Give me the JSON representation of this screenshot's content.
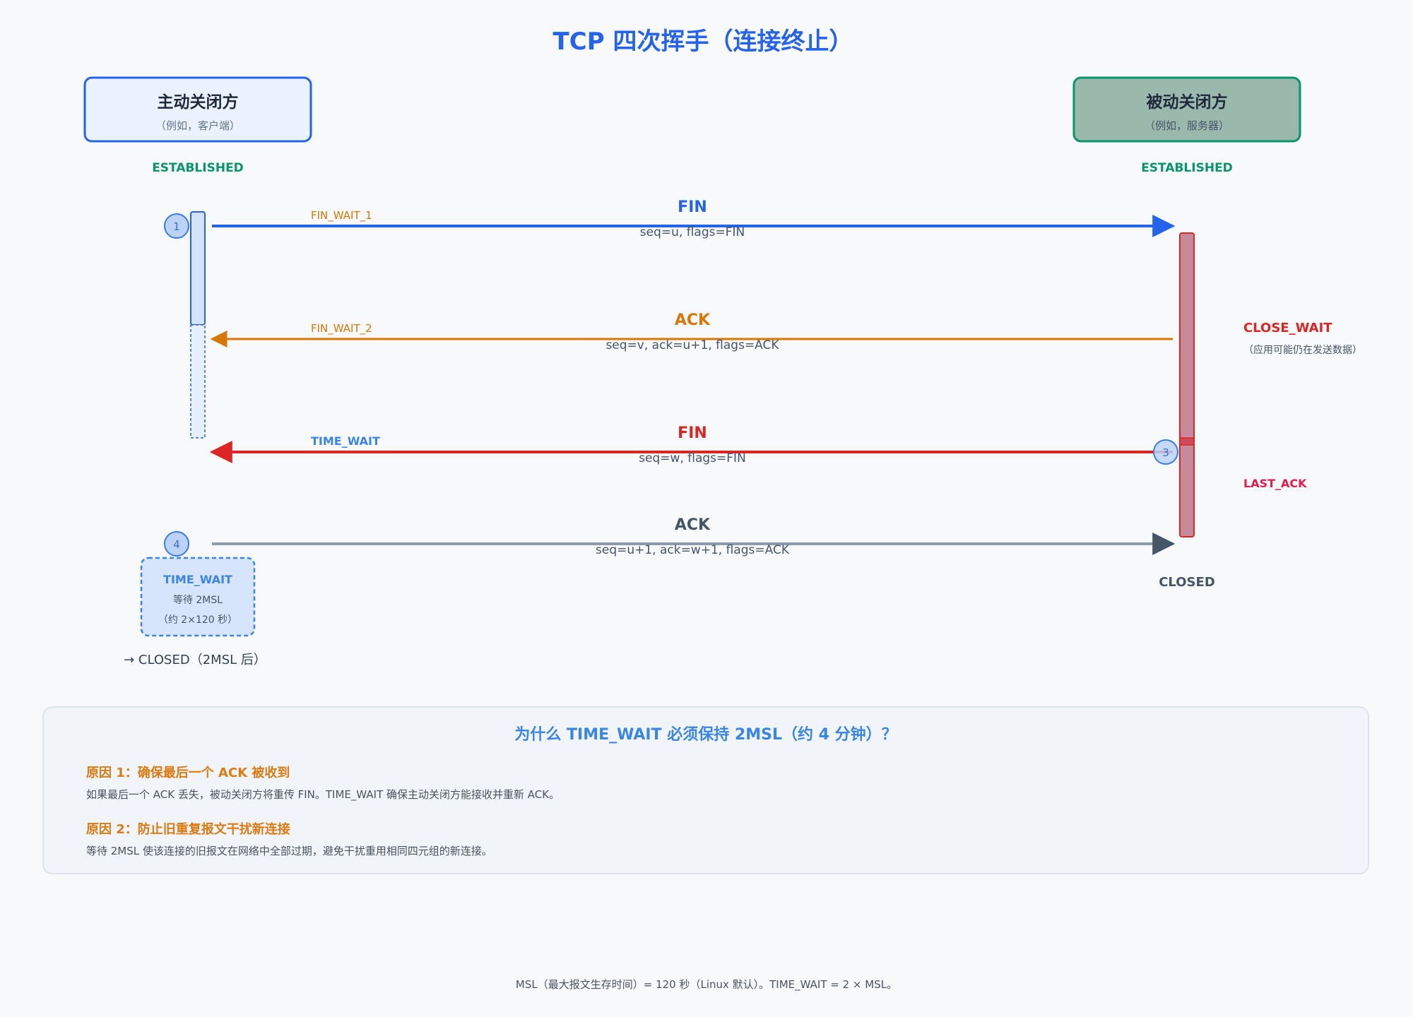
{
  "title": "TCP 四次挥手（连接终止）",
  "active_party": {
    "name": "主动关闭方",
    "sub": "（例如，客户端）",
    "initial_state": "ESTABLISHED",
    "time_wait_box": {
      "title": "TIME_WAIT",
      "line1": "等待 2MSL",
      "line2": "（约 2×120 秒）"
    },
    "final_state": "→ CLOSED（2MSL 后）"
  },
  "passive_party": {
    "name": "被动关闭方",
    "sub": "（例如，服务器）",
    "initial_state": "ESTABLISHED",
    "final_state": "CLOSED"
  },
  "messages": [
    {
      "step": "1",
      "label": "FIN",
      "detail": "seq=u, flags=FIN",
      "sender_state": "FIN_WAIT_1",
      "color": "#2563eb"
    },
    {
      "step": "",
      "label": "ACK",
      "detail": "seq=v, ack=u+1, flags=ACK",
      "sender_state": "FIN_WAIT_2",
      "color": "#d97706"
    },
    {
      "step": "3",
      "label": "FIN",
      "detail": "seq=w, flags=FIN",
      "sender_state": "TIME_WAIT",
      "color": "#dc2626"
    },
    {
      "step": "4",
      "label": "ACK",
      "detail": "seq=u+1, ack=w+1, flags=ACK",
      "sender_state": "",
      "color": "#475569"
    }
  ],
  "passive_states": {
    "close_wait": "CLOSE_WAIT",
    "close_wait_note": "（应用可能仍在发送数据）",
    "last_ack": "LAST_ACK"
  },
  "reasons": {
    "title": "为什么 TIME_WAIT 必须保持 2MSL（约 4 分钟）？",
    "items": [
      {
        "title": "原因 1：确保最后一个 ACK 被收到",
        "text": "如果最后一个 ACK 丢失，被动关闭方将重传 FIN。TIME_WAIT 确保主动关闭方能接收并重新 ACK。"
      },
      {
        "title": "原因 2：防止旧重复报文干扰新连接",
        "text": "等待 2MSL 使该连接的旧报文在网络中全部过期，避免干扰重用相同四元组的新连接。"
      }
    ]
  },
  "footer": "MSL（最大报文生存时间）= 120 秒（Linux 默认）。TIME_WAIT = 2 × MSL。",
  "colors": {
    "blue": "#2563eb",
    "orange": "#d97706",
    "red": "#dc2626",
    "slate": "#475569",
    "green": "#059669"
  }
}
